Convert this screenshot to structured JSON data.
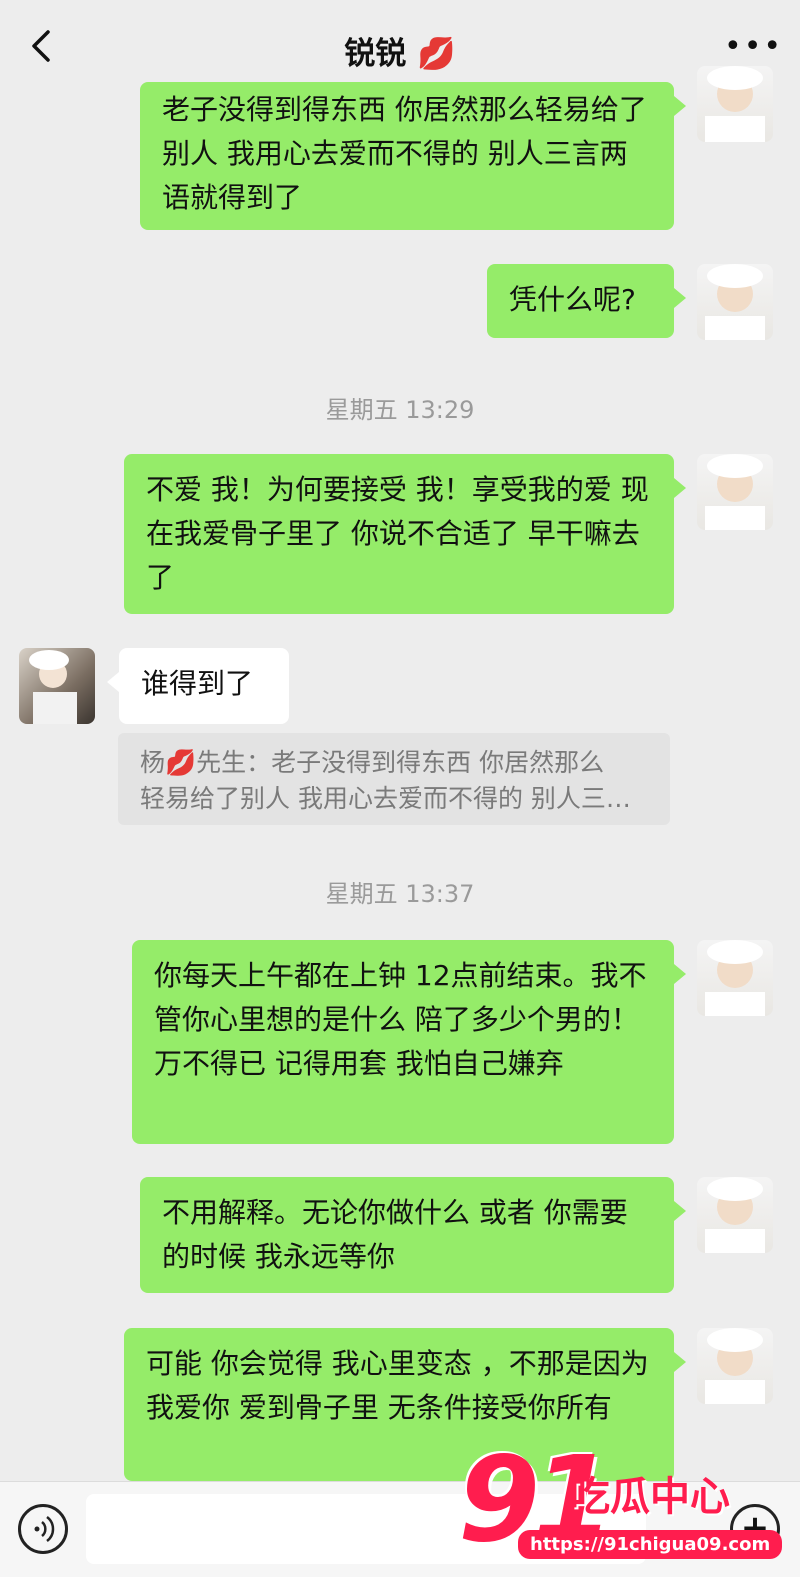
{
  "header": {
    "title": "锐锐",
    "title_emoji": "💋",
    "back_icon": "chevron-left-icon",
    "more_icon": "more-dots-icon"
  },
  "messages": [
    {
      "sender": "me",
      "text": "老子没得到得东西 你居然那么轻易给了别人 我用心去爱而不得的 别人三言两语就得到了"
    },
    {
      "sender": "me",
      "text": "凭什么呢?"
    },
    {
      "sender": "me",
      "text": "不爱 我！为何要接受 我！享受我的爱 现在我爱骨子里了 你说不合适了 早干嘛去了"
    },
    {
      "sender": "them",
      "text": "谁得到了"
    },
    {
      "sender": "me",
      "text": "你每天上午都在上钟 12点前结束。我不管你心里想的是什么 陪了多少个男的！ 万不得已 记得用套 我怕自己嫌弃"
    },
    {
      "sender": "me",
      "text": "不用解释。无论你做什么 或者 你需要的时候 我永远等你"
    },
    {
      "sender": "me",
      "text": "可能 你会觉得 我心里变态 ，不那是因为我爱你 爱到骨子里 无条件接受你所有"
    }
  ],
  "timestamps": [
    "星期五 13:29",
    "星期五 13:37"
  ],
  "quote": {
    "name_prefix": "杨",
    "name_emoji": "💋",
    "name_suffix": "先生：",
    "line1": "老子没得到得东西 你居然那么",
    "line2": "轻易给了别人 我用心去爱而不得的 别人三…"
  },
  "bottombar": {
    "voice_icon": "voice-icon",
    "plus_icon": "plus-icon"
  },
  "watermark": {
    "number": "91",
    "brand": "吃瓜中心",
    "url": "https://91chigua09.com"
  },
  "colors": {
    "my_bubble": "#95ec69",
    "their_bubble": "#ffffff",
    "background": "#ededed",
    "watermark": "#ff1d4e"
  }
}
